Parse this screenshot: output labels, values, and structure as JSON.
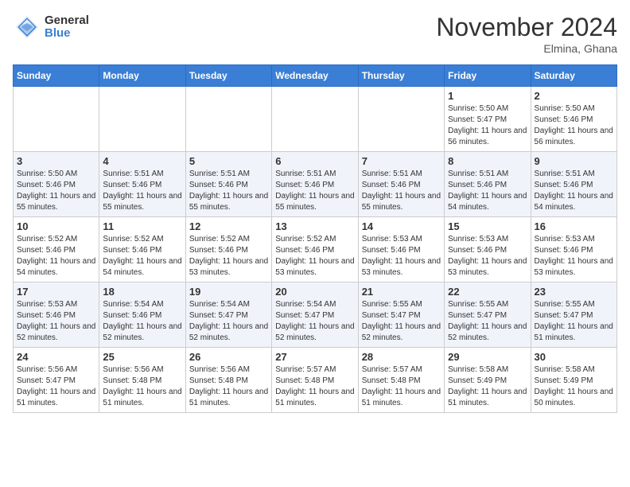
{
  "logo": {
    "general": "General",
    "blue": "Blue"
  },
  "header": {
    "month": "November 2024",
    "location": "Elmina, Ghana"
  },
  "weekdays": [
    "Sunday",
    "Monday",
    "Tuesday",
    "Wednesday",
    "Thursday",
    "Friday",
    "Saturday"
  ],
  "weeks": [
    [
      {
        "day": "",
        "sunrise": "",
        "sunset": "",
        "daylight": ""
      },
      {
        "day": "",
        "sunrise": "",
        "sunset": "",
        "daylight": ""
      },
      {
        "day": "",
        "sunrise": "",
        "sunset": "",
        "daylight": ""
      },
      {
        "day": "",
        "sunrise": "",
        "sunset": "",
        "daylight": ""
      },
      {
        "day": "",
        "sunrise": "",
        "sunset": "",
        "daylight": ""
      },
      {
        "day": "1",
        "sunrise": "Sunrise: 5:50 AM",
        "sunset": "Sunset: 5:47 PM",
        "daylight": "Daylight: 11 hours and 56 minutes."
      },
      {
        "day": "2",
        "sunrise": "Sunrise: 5:50 AM",
        "sunset": "Sunset: 5:46 PM",
        "daylight": "Daylight: 11 hours and 56 minutes."
      }
    ],
    [
      {
        "day": "3",
        "sunrise": "Sunrise: 5:50 AM",
        "sunset": "Sunset: 5:46 PM",
        "daylight": "Daylight: 11 hours and 55 minutes."
      },
      {
        "day": "4",
        "sunrise": "Sunrise: 5:51 AM",
        "sunset": "Sunset: 5:46 PM",
        "daylight": "Daylight: 11 hours and 55 minutes."
      },
      {
        "day": "5",
        "sunrise": "Sunrise: 5:51 AM",
        "sunset": "Sunset: 5:46 PM",
        "daylight": "Daylight: 11 hours and 55 minutes."
      },
      {
        "day": "6",
        "sunrise": "Sunrise: 5:51 AM",
        "sunset": "Sunset: 5:46 PM",
        "daylight": "Daylight: 11 hours and 55 minutes."
      },
      {
        "day": "7",
        "sunrise": "Sunrise: 5:51 AM",
        "sunset": "Sunset: 5:46 PM",
        "daylight": "Daylight: 11 hours and 55 minutes."
      },
      {
        "day": "8",
        "sunrise": "Sunrise: 5:51 AM",
        "sunset": "Sunset: 5:46 PM",
        "daylight": "Daylight: 11 hours and 54 minutes."
      },
      {
        "day": "9",
        "sunrise": "Sunrise: 5:51 AM",
        "sunset": "Sunset: 5:46 PM",
        "daylight": "Daylight: 11 hours and 54 minutes."
      }
    ],
    [
      {
        "day": "10",
        "sunrise": "Sunrise: 5:52 AM",
        "sunset": "Sunset: 5:46 PM",
        "daylight": "Daylight: 11 hours and 54 minutes."
      },
      {
        "day": "11",
        "sunrise": "Sunrise: 5:52 AM",
        "sunset": "Sunset: 5:46 PM",
        "daylight": "Daylight: 11 hours and 54 minutes."
      },
      {
        "day": "12",
        "sunrise": "Sunrise: 5:52 AM",
        "sunset": "Sunset: 5:46 PM",
        "daylight": "Daylight: 11 hours and 53 minutes."
      },
      {
        "day": "13",
        "sunrise": "Sunrise: 5:52 AM",
        "sunset": "Sunset: 5:46 PM",
        "daylight": "Daylight: 11 hours and 53 minutes."
      },
      {
        "day": "14",
        "sunrise": "Sunrise: 5:53 AM",
        "sunset": "Sunset: 5:46 PM",
        "daylight": "Daylight: 11 hours and 53 minutes."
      },
      {
        "day": "15",
        "sunrise": "Sunrise: 5:53 AM",
        "sunset": "Sunset: 5:46 PM",
        "daylight": "Daylight: 11 hours and 53 minutes."
      },
      {
        "day": "16",
        "sunrise": "Sunrise: 5:53 AM",
        "sunset": "Sunset: 5:46 PM",
        "daylight": "Daylight: 11 hours and 53 minutes."
      }
    ],
    [
      {
        "day": "17",
        "sunrise": "Sunrise: 5:53 AM",
        "sunset": "Sunset: 5:46 PM",
        "daylight": "Daylight: 11 hours and 52 minutes."
      },
      {
        "day": "18",
        "sunrise": "Sunrise: 5:54 AM",
        "sunset": "Sunset: 5:46 PM",
        "daylight": "Daylight: 11 hours and 52 minutes."
      },
      {
        "day": "19",
        "sunrise": "Sunrise: 5:54 AM",
        "sunset": "Sunset: 5:47 PM",
        "daylight": "Daylight: 11 hours and 52 minutes."
      },
      {
        "day": "20",
        "sunrise": "Sunrise: 5:54 AM",
        "sunset": "Sunset: 5:47 PM",
        "daylight": "Daylight: 11 hours and 52 minutes."
      },
      {
        "day": "21",
        "sunrise": "Sunrise: 5:55 AM",
        "sunset": "Sunset: 5:47 PM",
        "daylight": "Daylight: 11 hours and 52 minutes."
      },
      {
        "day": "22",
        "sunrise": "Sunrise: 5:55 AM",
        "sunset": "Sunset: 5:47 PM",
        "daylight": "Daylight: 11 hours and 52 minutes."
      },
      {
        "day": "23",
        "sunrise": "Sunrise: 5:55 AM",
        "sunset": "Sunset: 5:47 PM",
        "daylight": "Daylight: 11 hours and 51 minutes."
      }
    ],
    [
      {
        "day": "24",
        "sunrise": "Sunrise: 5:56 AM",
        "sunset": "Sunset: 5:47 PM",
        "daylight": "Daylight: 11 hours and 51 minutes."
      },
      {
        "day": "25",
        "sunrise": "Sunrise: 5:56 AM",
        "sunset": "Sunset: 5:48 PM",
        "daylight": "Daylight: 11 hours and 51 minutes."
      },
      {
        "day": "26",
        "sunrise": "Sunrise: 5:56 AM",
        "sunset": "Sunset: 5:48 PM",
        "daylight": "Daylight: 11 hours and 51 minutes."
      },
      {
        "day": "27",
        "sunrise": "Sunrise: 5:57 AM",
        "sunset": "Sunset: 5:48 PM",
        "daylight": "Daylight: 11 hours and 51 minutes."
      },
      {
        "day": "28",
        "sunrise": "Sunrise: 5:57 AM",
        "sunset": "Sunset: 5:48 PM",
        "daylight": "Daylight: 11 hours and 51 minutes."
      },
      {
        "day": "29",
        "sunrise": "Sunrise: 5:58 AM",
        "sunset": "Sunset: 5:49 PM",
        "daylight": "Daylight: 11 hours and 51 minutes."
      },
      {
        "day": "30",
        "sunrise": "Sunrise: 5:58 AM",
        "sunset": "Sunset: 5:49 PM",
        "daylight": "Daylight: 11 hours and 50 minutes."
      }
    ]
  ]
}
